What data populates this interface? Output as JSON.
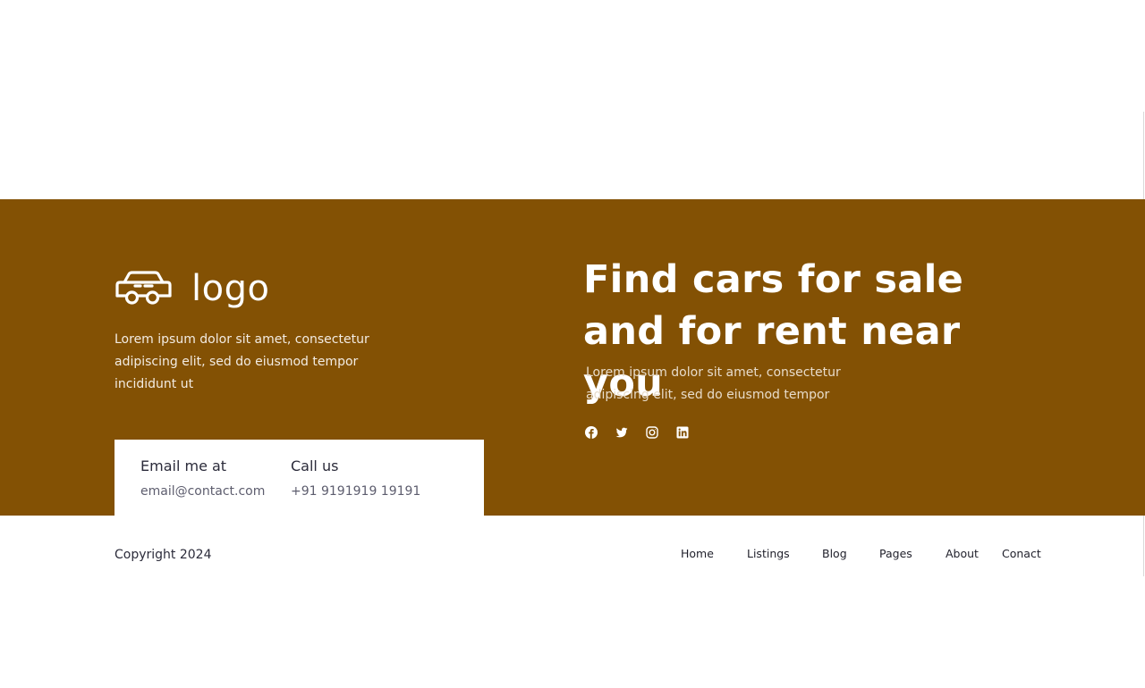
{
  "brand": {
    "logo_text": "logo",
    "logo_icon": "car-icon",
    "description": "Lorem ipsum dolor sit amet, consectetur adipiscing elit, sed do eiusmod tempor incididunt ut"
  },
  "contact": {
    "email_label": "Email me at",
    "email_value": "email@contact.com",
    "call_label": "Call us",
    "call_value": "+91 9191919 19191"
  },
  "hero": {
    "headline": "Find cars for sale and for rent near you",
    "description": "Lorem ipsum dolor sit amet, consectetur adipiscing elit, sed do eiusmod tempor"
  },
  "social": [
    {
      "icon": "facebook-icon"
    },
    {
      "icon": "twitter-icon"
    },
    {
      "icon": "instagram-icon"
    },
    {
      "icon": "linkedin-icon"
    }
  ],
  "footer": {
    "copyright": "Copyright 2024",
    "nav": [
      "Home",
      "Listings",
      "Blog",
      "Pages",
      "About",
      "Conact"
    ]
  },
  "colors": {
    "band": "#835104",
    "text_light": "#ffffff",
    "text_dark": "#2b2b3a"
  }
}
